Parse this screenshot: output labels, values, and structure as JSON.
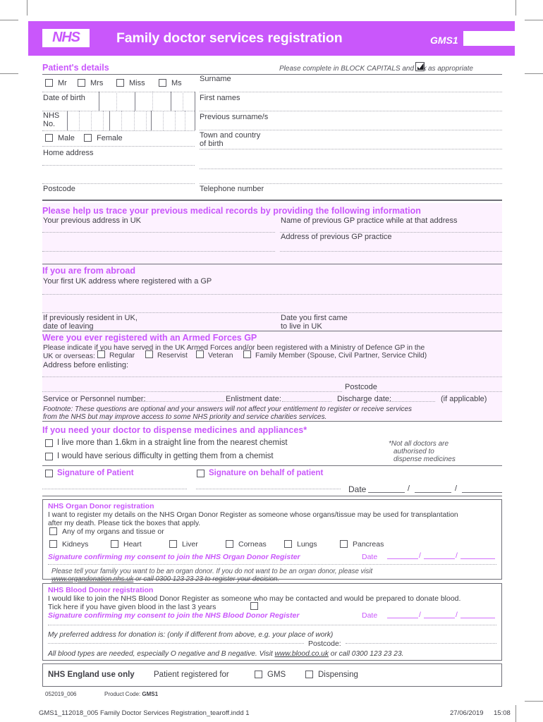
{
  "header": {
    "logo": "NHS",
    "title": "Family doctor services registration",
    "form_code": "GMS1",
    "accent_color": "#c957fb",
    "panel_color": "#fdf2ff"
  },
  "patient": {
    "section_title": "Patient's details",
    "instruction_pre": "Please complete in BLOCK CAPITALS and tick",
    "instruction_post": "as appropriate",
    "titles": [
      "Mr",
      "Mrs",
      "Miss",
      "Ms"
    ],
    "dob_label": "Date of birth",
    "nhs_no_label_1": "NHS",
    "nhs_no_label_2": "No.",
    "sex": [
      "Male",
      "Female"
    ],
    "home_address_label": "Home address",
    "postcode_label": "Postcode",
    "surname_label": "Surname",
    "first_names_label": "First names",
    "previous_surnames_label": "Previous surname/s",
    "town_country_label_1": "Town and country",
    "town_country_label_2": "of birth",
    "telephone_label": "Telephone number"
  },
  "trace": {
    "section_title": "Please help us trace your previous medical records by providing the following information",
    "previous_address_label": "Your previous address in UK",
    "previous_practice_name_label": "Name of previous GP practice while at that address",
    "previous_practice_address_label": "Address of previous GP practice"
  },
  "abroad": {
    "section_title": "If you are from abroad",
    "first_uk_address_label": "Your first UK address where registered with a GP",
    "date_of_leaving_label_1": "If previously resident in UK,",
    "date_of_leaving_label_2": "date of leaving",
    "date_first_came_label_1": "Date you first came",
    "date_first_came_label_2": "to live in UK"
  },
  "armed_forces": {
    "section_title": "Were you ever registered with an Armed Forces GP",
    "intro_line1": "Please indicate if you have served in the UK Armed Forces and/or been registered with a Ministry of Defence GP in the",
    "intro_line2_prefix": "UK or overseas:",
    "options": [
      "Regular",
      "Reservist",
      "Veteran",
      "Family Member (Spouse, Civil Partner, Service Child)"
    ],
    "address_label": "Address before enlisting:",
    "postcode_label": "Postcode",
    "service_number_label": "Service or Personnel number:",
    "enlistment_label": "Enlistment date:",
    "discharge_label": "Discharge date:",
    "if_applicable": "(if applicable)",
    "footnote_line1": "Footnote: These questions are optional and your answers will not affect your entitlement to register or receive services",
    "footnote_line2": "from the NHS but may improve access to some NHS priority and service charities services."
  },
  "dispense": {
    "section_title": "If you need your doctor to dispense medicines and appliances*",
    "option_1": "I live more than 1.6km in a straight line from the nearest chemist",
    "option_2": "I would have serious difficulty in getting them from a chemist",
    "note_line1": "*Not all doctors are",
    "note_line2": "authorised to",
    "note_line3": "dispense medicines",
    "signature_patient": "Signature of Patient",
    "signature_behalf": "Signature on behalf of patient",
    "date_label": "Date",
    "slash": "/"
  },
  "organ_donor": {
    "section_title": "NHS Organ Donor registration",
    "intro_line1": "I want to register my details on the NHS Organ Donor Register as someone whose organs/tissue may be used for transplantation",
    "intro_line2": "after my death. Please tick the boxes that apply.",
    "any_organs_label": "Any of my organs and tissue or",
    "organs": [
      "Kidneys",
      "Heart",
      "Liver",
      "Corneas",
      "Lungs",
      "Pancreas"
    ],
    "consent_label": "Signature confirming my consent to join the NHS Organ Donor Register",
    "date_label": "Date",
    "slash": "/",
    "note_line1": "Please tell your family you want to be an organ donor. If you do not want to be an organ donor, please visit",
    "note_link": "www.organdonation.nhs.uk",
    "note_line2_rest": " or call 0300 123 23 23 to register your decision."
  },
  "blood_donor": {
    "section_title": "NHS Blood Donor registration",
    "intro_line1": "I would like to join the NHS Blood Donor Register as someone who may be contacted and would be prepared to donate blood.",
    "tick_label": "Tick here if you have given blood in the last 3 years",
    "consent_label": "Signature confirming my consent to join the NHS Blood Donor Register",
    "date_label": "Date",
    "slash": "/",
    "preferred_address_label": "My preferred address for donation is: (only if different from above, e.g. your place of work)",
    "postcode_label": "Postcode:",
    "note_prefix": "All blood types are needed, especially O negative and B negative. Visit ",
    "note_link": "www.blood.co.uk",
    "note_suffix": " or call 0300 123 23 23."
  },
  "official_use": {
    "title": "NHS England use only",
    "registered_for_label": "Patient registered for",
    "options": [
      "GMS",
      "Dispensing"
    ]
  },
  "print_footer": {
    "revision": "052019_006",
    "product_code_label": "Product Code:",
    "product_code": "GMS1",
    "filename": "GMS1_112018_005 Family Doctor Services Registration_tearoff.indd   1",
    "date": "27/06/2019",
    "time": "15:08"
  }
}
